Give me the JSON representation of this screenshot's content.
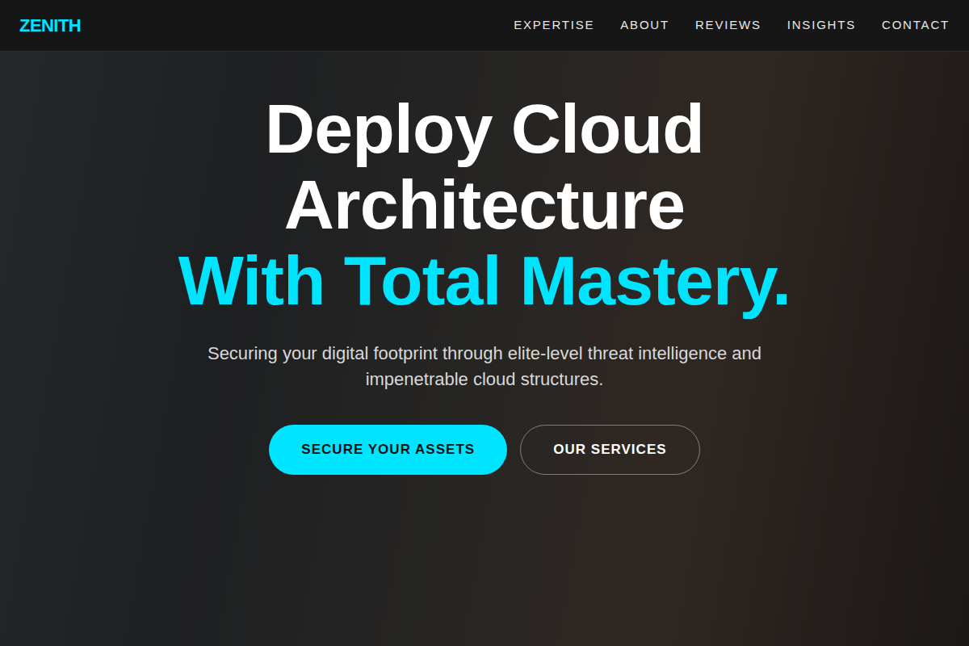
{
  "nav": {
    "logo": "ZENITH",
    "links": [
      "EXPERTISE",
      "ABOUT",
      "REVIEWS",
      "INSIGHTS",
      "CONTACT"
    ]
  },
  "hero": {
    "heading_line1": "Deploy Cloud Architecture",
    "heading_line2": "With Total Mastery.",
    "subtitle": "Securing your digital footprint through elite-level threat intelligence and impenetrable cloud structures.",
    "buttons": [
      {
        "label": "SECURE YOUR ASSETS",
        "kind": "primary"
      },
      {
        "label": "OUR SERVICES",
        "kind": "outline"
      }
    ]
  }
}
